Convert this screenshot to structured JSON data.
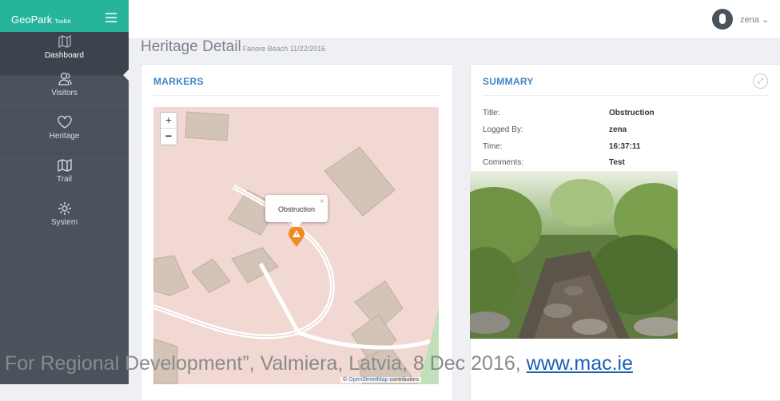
{
  "app": {
    "brand": "GeoPark",
    "brand_suffix": "Toolkit"
  },
  "user": {
    "name": "zena",
    "caret": "⌄"
  },
  "sidebar": {
    "items": [
      {
        "label": "Dashboard",
        "icon": "map-icon",
        "active": true
      },
      {
        "label": "Visitors",
        "icon": "users-icon"
      },
      {
        "label": "Heritage",
        "icon": "heart-icon"
      },
      {
        "label": "Trail",
        "icon": "map-icon"
      },
      {
        "label": "System",
        "icon": "gear-icon"
      }
    ]
  },
  "page": {
    "title": "Heritage Detail",
    "subtitle": "Fanore Beach 11/22/2016"
  },
  "markers": {
    "title": "MARKERS",
    "zoom_in": "+",
    "zoom_out": "−",
    "popup_text": "Obstruction",
    "popup_close": "×",
    "attribution_prefix": "©",
    "attribution_link": "OpenStreetMap",
    "attribution_suffix": "contributors"
  },
  "summary": {
    "title": "SUMMARY",
    "expand": "⤢",
    "fields": [
      {
        "label": "Title:",
        "value": "Obstruction"
      },
      {
        "label": "Logged By:",
        "value": "zena"
      },
      {
        "label": "Time:",
        "value": "16:37:11"
      },
      {
        "label": "Comments:",
        "value": "Test"
      }
    ]
  },
  "caption": {
    "text": "For Regional Development”, Valmiera, Latvia, 8 Dec 2016, ",
    "link": "www.mac.ie"
  },
  "colors": {
    "accent": "#26b59c",
    "sidebar": "#4a525c",
    "panel_title": "#3f86c7",
    "marker": "#f08a24"
  }
}
